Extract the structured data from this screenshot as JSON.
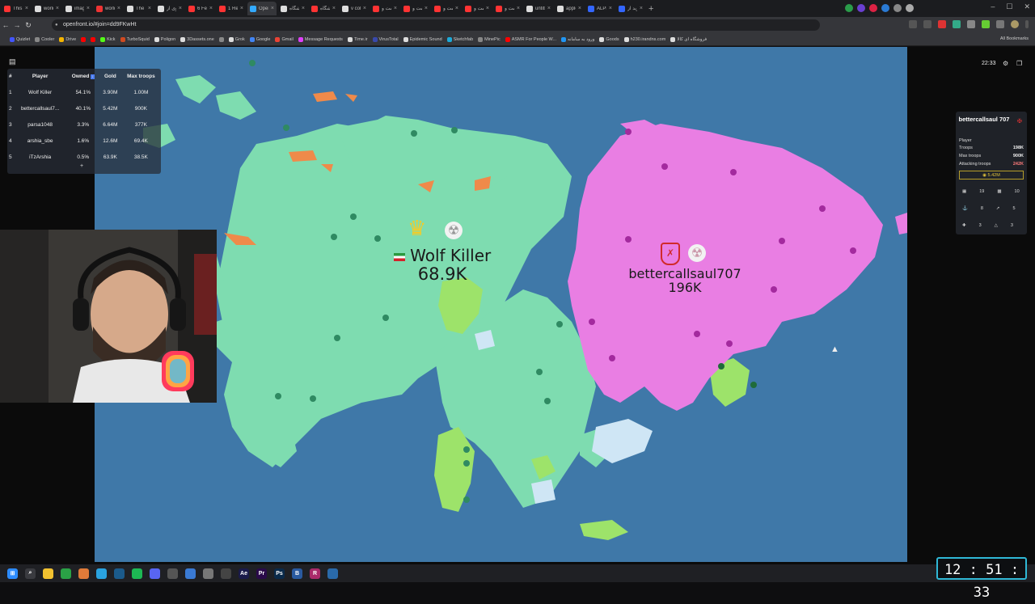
{
  "browser": {
    "tabs": [
      {
        "title": "This Ma",
        "color": "#ff3333",
        "active": false
      },
      {
        "title": "world",
        "color": "#dddddd",
        "active": false
      },
      {
        "title": "images",
        "color": "#dddddd",
        "active": false
      },
      {
        "title": "world-",
        "color": "#ee3333",
        "active": false
      },
      {
        "title": "The Tru",
        "color": "#dddddd",
        "active": false
      },
      {
        "title": "پهلوی از",
        "color": "#dddddd",
        "active": false
      },
      {
        "title": "6 Femal",
        "color": "#ff3333",
        "active": false
      },
      {
        "title": "1 Real V",
        "color": "#ff3333",
        "active": false
      },
      {
        "title": "OpenFr",
        "color": "#33aaff",
        "active": true
      },
      {
        "title": "فروشگاه",
        "color": "#dddddd",
        "active": false
      },
      {
        "title": "فروشگاه",
        "color": "#ff3333",
        "active": false
      },
      {
        "title": "v color",
        "color": "#dddddd",
        "active": false
      },
      {
        "title": "قیمت و",
        "color": "#ff3333",
        "active": false
      },
      {
        "title": "قیمت و",
        "color": "#ff3333",
        "active": false
      },
      {
        "title": "قیمت و",
        "color": "#ff3333",
        "active": false
      },
      {
        "title": "قیمت و",
        "color": "#ff3333",
        "active": false
      },
      {
        "title": "قیمت و",
        "color": "#ff3333",
        "active": false
      },
      {
        "title": "untitled",
        "color": "#dddddd",
        "active": false
      },
      {
        "title": "apple s",
        "color": "#dddddd",
        "active": false
      },
      {
        "title": "ALPHA",
        "color": "#3366ff",
        "active": false
      },
      {
        "title": "خرید از",
        "color": "#3366ff",
        "active": false
      }
    ],
    "new_tab": "+",
    "url": "openfront.io/#join=dd9FKwHt",
    "bookmarks": [
      {
        "label": "Quizlet",
        "color": "#4255ff"
      },
      {
        "label": "Cooler",
        "color": "#888888"
      },
      {
        "label": "Drive",
        "color": "#f4b400"
      },
      {
        "label": "",
        "color": "#ff0000"
      },
      {
        "label": "",
        "color": "#ff0000"
      },
      {
        "label": "Kick",
        "color": "#53fc18"
      },
      {
        "label": "TurboSquid",
        "color": "#d04a20"
      },
      {
        "label": "Poligon",
        "color": "#dddddd"
      },
      {
        "label": "3Dassets.one",
        "color": "#dddddd"
      },
      {
        "label": "",
        "color": "#888888"
      },
      {
        "label": "Grok",
        "color": "#dddddd"
      },
      {
        "label": "Google",
        "color": "#4285f4"
      },
      {
        "label": "Gmail",
        "color": "#ea4335"
      },
      {
        "label": "Message Requests",
        "color": "#e040fb"
      },
      {
        "label": "Time.ir",
        "color": "#dddddd"
      },
      {
        "label": "VirusTotal",
        "color": "#3949ab"
      },
      {
        "label": "Epidemic Sound",
        "color": "#dddddd"
      },
      {
        "label": "Sketchfab",
        "color": "#1caad9"
      },
      {
        "label": "MinePic",
        "color": "#888888"
      },
      {
        "label": "ASMR For People W...",
        "color": "#ff0000"
      },
      {
        "label": "ورود به سامانه",
        "color": "#2196f3"
      },
      {
        "label": "Goods",
        "color": "#dddddd"
      },
      {
        "label": "h230.irandns.com",
        "color": "#dddddd"
      },
      {
        "label": "فروشگاه ای کالا",
        "color": "#dddddd"
      }
    ],
    "all_bookmarks": "All Bookmarks"
  },
  "leaderboard": {
    "headers": [
      "#",
      "Player",
      "Owned",
      "Gold",
      "Max troops"
    ],
    "rows": [
      [
        "1",
        "Wolf Killer",
        "54.1%",
        "3.90M",
        "1.00M"
      ],
      [
        "2",
        "bettercallsaul7...",
        "40.1%",
        "5.42M",
        "900K"
      ],
      [
        "3",
        "parsa1048",
        "3.3%",
        "6.64M",
        "377K"
      ],
      [
        "4",
        "arshia_sbe",
        "1.6%",
        "12.6M",
        "69.4K"
      ],
      [
        "5",
        "iTzArshia",
        "0.5%",
        "63.9K",
        "38.5K"
      ]
    ],
    "add_button": "+"
  },
  "hud": {
    "game_time": "22:33",
    "settings_icon": "gear-icon",
    "exit_icon": "exit-icon"
  },
  "player_panel": {
    "name": "bettercallsaul 707",
    "type_label": "Player",
    "rows": [
      {
        "label": "Troops",
        "value": "198K",
        "color": "#eeeeee"
      },
      {
        "label": "Max troops",
        "value": "900K",
        "color": "#eeeeee"
      },
      {
        "label": "Attacking troops",
        "value": "242K",
        "color": "#ff7b7b"
      }
    ],
    "gold": "5.42M",
    "stats": [
      [
        "19",
        "10"
      ],
      [
        "8",
        "5"
      ],
      [
        "3",
        "3"
      ]
    ]
  },
  "territories": [
    {
      "name": "Wolf Killer",
      "troops": "68.9K",
      "color": "#7edcb0"
    },
    {
      "name": "bettercallsaul707",
      "troops": "196K",
      "color": "#e97ee3"
    }
  ],
  "colors": {
    "ocean": "#3f78a8",
    "green_player": "#7edcb0",
    "pink_player": "#e97ee3",
    "lime_player": "#9de36a",
    "orange_player": "#ef8a4a"
  },
  "clock": "12 : 51 : 33"
}
